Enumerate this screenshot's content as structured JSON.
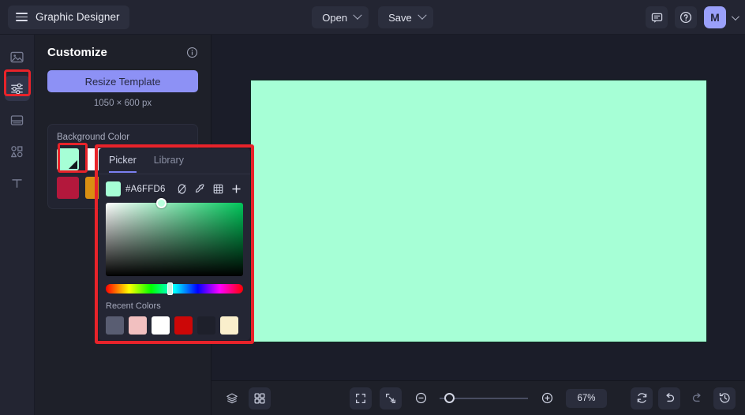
{
  "topbar": {
    "menu_icon": "hamburger-icon",
    "doc_title": "Graphic Designer",
    "open_label": "Open",
    "save_label": "Save",
    "comment_icon": "comment-icon",
    "help_icon": "help-circle-icon",
    "avatar_initial": "M"
  },
  "rail": {
    "items": [
      {
        "name": "sidebar-item-media",
        "icon": "image-icon",
        "active": false
      },
      {
        "name": "sidebar-item-customize",
        "icon": "sliders-icon",
        "active": true
      },
      {
        "name": "sidebar-item-layout",
        "icon": "layout-icon",
        "active": false
      },
      {
        "name": "sidebar-item-elements",
        "icon": "shapes-icon",
        "active": false
      },
      {
        "name": "sidebar-item-text",
        "icon": "text-icon",
        "active": false
      }
    ]
  },
  "panel": {
    "title": "Customize",
    "info_icon": "info-icon",
    "resize_label": "Resize Template",
    "dimensions": "1050 × 600 px",
    "background": {
      "label": "Background Color",
      "swatches": [
        [
          "#a6ffd6",
          "#ffffff",
          "#f2b33a"
        ],
        [
          "#b3183c",
          "#d98f12",
          "#2f3444"
        ]
      ]
    }
  },
  "picker": {
    "tabs": [
      {
        "label": "Picker",
        "active": true
      },
      {
        "label": "Library",
        "active": false
      }
    ],
    "hex": "#A6FFD6",
    "swatch_color": "#a6ffd6",
    "tools": [
      "no-color-icon",
      "eyedropper-icon",
      "palette-grid-icon",
      "add-icon"
    ],
    "recent_label": "Recent Colors",
    "recent_colors": [
      "#595d72",
      "#f2c0c0",
      "#ffffff",
      "#cc0707",
      "#1e202b",
      "#faefcc"
    ]
  },
  "canvas": {
    "background_color": "#a6ffd6"
  },
  "bottombar": {
    "layers_icon": "layers-icon",
    "grid_icon": "grid-icon",
    "fit_icon": "fit-screen-icon",
    "collapse_icon": "collapse-icon",
    "zoom_out_icon": "zoom-out-icon",
    "zoom_in_icon": "zoom-in-icon",
    "zoom_value": "67%",
    "reset_icon": "reset-icon",
    "undo_icon": "undo-icon",
    "redo_icon": "redo-icon",
    "history_icon": "history-icon"
  }
}
